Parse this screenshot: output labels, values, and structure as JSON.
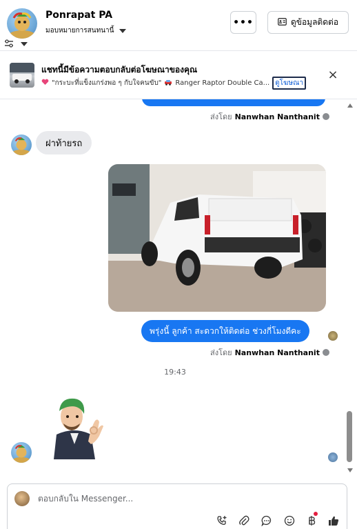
{
  "header": {
    "contact_name": "Ponrapat PA",
    "assign_label": "มอบหมายการสนทนานี้",
    "more_label": "•••",
    "contact_info_label": "ดูข้อมูลติดต่อ"
  },
  "ad_banner": {
    "title": "แชทนี้มีข้อความตอบกลับต่อโฆษณาของคุณ",
    "ad_text": "\"กระบะที่แข็งแกร่งพอ ๆ กับใจคนขับ\"",
    "car_name": "Ranger Raptor Double Ca...",
    "view_ad_label": "ดูโฆษณา",
    "close_label": "×"
  },
  "messages": {
    "sent_by_prefix": "ส่งโดย",
    "sender_name": "Nanwhan Nanthanit",
    "incoming_text": "ฝาท้ายรถ",
    "outgoing_text": "พรุ่งนี้ ลูกค้า สะดวกให้ติดต่อ ช่วงกี่โมงดีคะ",
    "timestamp": "19:43"
  },
  "composer": {
    "placeholder": "ตอบกลับใน Messenger..."
  },
  "colors": {
    "accent_blue": "#1877f2",
    "incoming_bubble": "#e9eaed",
    "secondary_text": "#65676b"
  }
}
